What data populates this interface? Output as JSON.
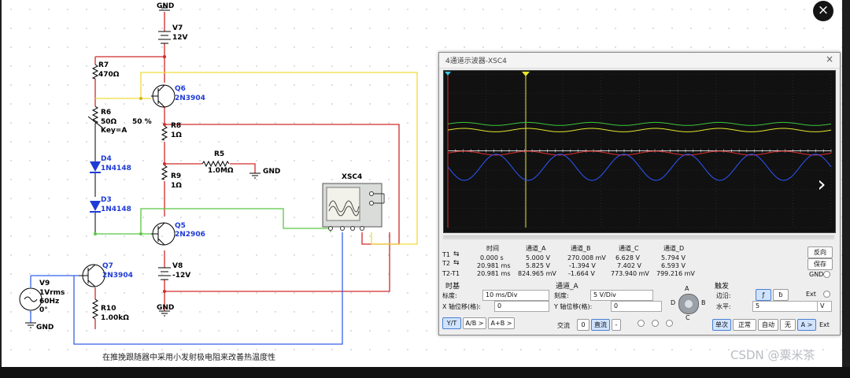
{
  "viewer": {
    "close_glyph": "×",
    "next_glyph": "›",
    "watermark": "CSDN @粟米茶"
  },
  "circuit": {
    "gnd_label": "GND",
    "v7": {
      "name": "V7",
      "value": "12V"
    },
    "r7": {
      "name": "R7",
      "value": "470Ω"
    },
    "q6": {
      "name": "Q6",
      "model": "2N3904"
    },
    "r6": {
      "name": "R6",
      "value": "50Ω",
      "key": "Key=A",
      "percent": "50 %"
    },
    "r8": {
      "name": "R8",
      "value": "1Ω"
    },
    "r5": {
      "name": "R5",
      "value": "1.0MΩ"
    },
    "d4": {
      "name": "D4",
      "model": "1N4148"
    },
    "r9": {
      "name": "R9",
      "value": "1Ω"
    },
    "d3": {
      "name": "D3",
      "model": "1N4148"
    },
    "xsc4": "XSC4",
    "q5": {
      "name": "Q5",
      "model": "2N2906"
    },
    "q7": {
      "name": "Q7",
      "model": "2N3904"
    },
    "v8": {
      "name": "V8",
      "value": "-12V"
    },
    "v9": {
      "name": "V9",
      "line1": "1Vrms",
      "line2": "60Hz",
      "line3": "0°"
    },
    "r10": {
      "name": "R10",
      "value": "1.00kΩ"
    },
    "caption": "在推挽跟随器中采用小发射极电阻来改善热温度性"
  },
  "scope": {
    "title": "4通道示波器-XSC4",
    "close": "×",
    "trace_colors": {
      "a": "#e6e62e",
      "b": "#e03030",
      "c": "#3ec63e",
      "d": "#2f56ff"
    },
    "readout": {
      "headers": [
        "时间",
        "通道_A",
        "通道_B",
        "通道_C",
        "通道_D"
      ],
      "rows": [
        {
          "label": "T1",
          "values": [
            "0.000 s",
            "5.000 V",
            "270.008 mV",
            "6.628 V",
            "5.794 V"
          ]
        },
        {
          "label": "T2",
          "values": [
            "20.981 ms",
            "5.825 V",
            "-1.394 V",
            "7.402 V",
            "6.593 V"
          ]
        },
        {
          "label": "T2-T1",
          "values": [
            "20.981 ms",
            "824.965 mV",
            "-1.664 V",
            "773.940 mV",
            "799.216 mV"
          ]
        }
      ],
      "reverse": "反向",
      "save": "保存",
      "gnd": "GND"
    },
    "timebase": {
      "title": "时基",
      "scale_label": "标度:",
      "scale_value": "10 ms/Div",
      "xpos_label": "X 轴位移(格):",
      "xpos_value": "0",
      "buttons": [
        "Y/T",
        "A/B >",
        "A+B >"
      ]
    },
    "channel": {
      "title": "通道_A",
      "scale_label": "刻度:",
      "scale_value": "5  V/Div",
      "ypos_label": "Y 轴位移(格):",
      "ypos_value": "0",
      "ac": "交流",
      "zero": "0",
      "dc": "直流",
      "minus": "-",
      "knob_letters": [
        "A",
        "B",
        "C",
        "D"
      ]
    },
    "trigger": {
      "title": "触发",
      "edge_label": "边沿:",
      "edge_rise": "ƒ",
      "edge_fall": "ƀ",
      "ext": "Ext",
      "level_label": "水平:",
      "level_value": "5",
      "level_unit": "V",
      "modes": [
        "单次",
        "正常",
        "自动",
        "无",
        "A >",
        "Ext"
      ]
    }
  }
}
